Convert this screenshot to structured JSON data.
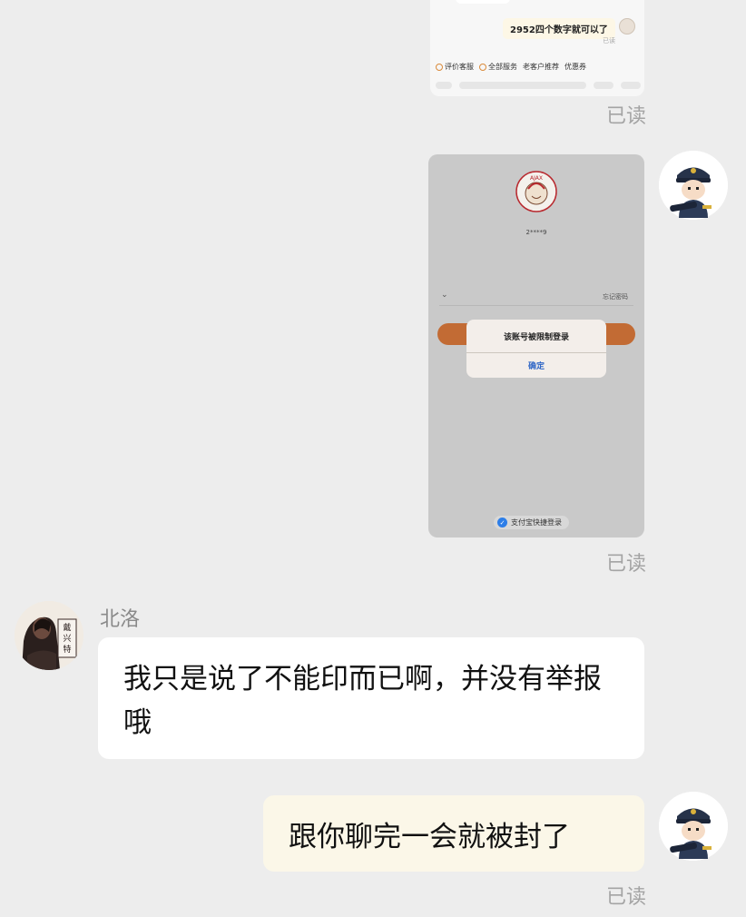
{
  "chat": {
    "top_screenshot": {
      "message": "2952四个数字就可以了",
      "read_small": "已读",
      "quick_actions": [
        "评价客服",
        "全部服务",
        "老客户推荐",
        "优惠券"
      ]
    },
    "read_label_1": "已读",
    "login_screenshot": {
      "logo_text": "AJAX",
      "masked_account": "2****9",
      "forgot_password": "忘记密码",
      "alert_message": "该账号被限制登录",
      "alert_confirm": "确定",
      "alipay_login": "支付宝快捷登录",
      "accent_color": "#c26b34"
    },
    "read_label_2": "已读",
    "incoming": {
      "sender": "北洛",
      "avatar_text": "戴兴特",
      "text": "我只是说了不能印而已啊，并没有举报哦"
    },
    "outgoing": {
      "text": "跟你聊完一会就被封了"
    },
    "read_label_3": "已读"
  }
}
